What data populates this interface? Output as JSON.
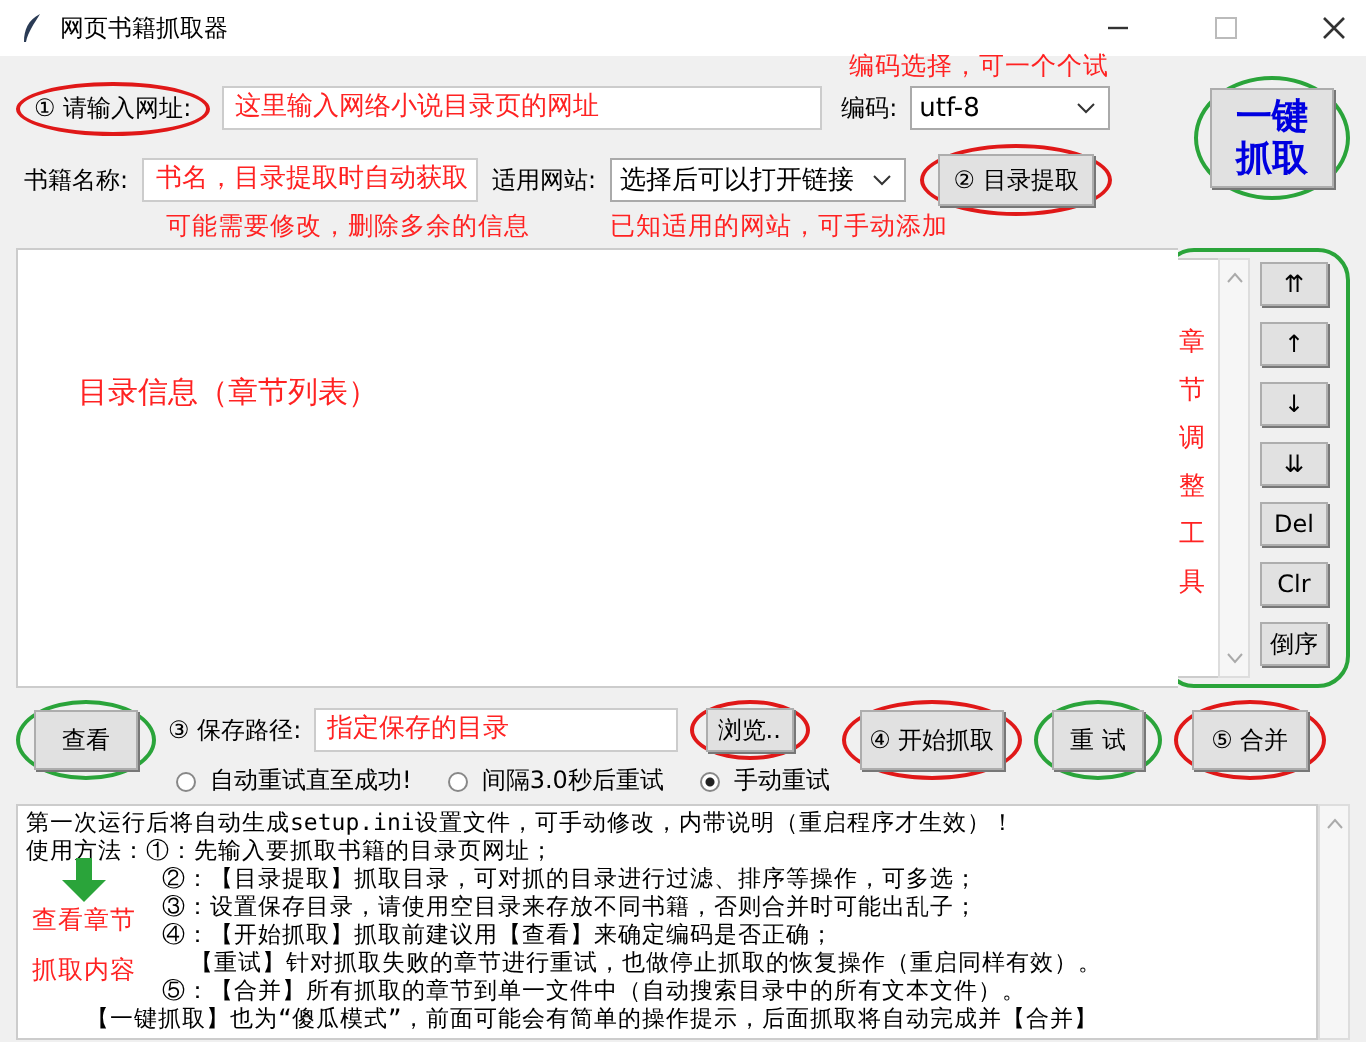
{
  "window": {
    "title": "网页书籍抓取器"
  },
  "url_row": {
    "label": "① 请输入网址:",
    "value": "这里输入网络小说目录页的网址",
    "encoding_label": "编码:",
    "encoding": "utf-8"
  },
  "one_click_button": "一键抓取",
  "book_row": {
    "label": "书籍名称:",
    "value": "书名，目录提取时自动获取",
    "site_label": "适用网站:",
    "site": "选择后可以打开链接",
    "extract_button": "② 目录提取"
  },
  "chapter_list": {
    "annotation": "目录信息（章节列表）"
  },
  "tool_buttons": [
    "⇈",
    "↑",
    "↓",
    "⇊",
    "Del",
    "Clr",
    "倒序"
  ],
  "save_row": {
    "view_button": "查看",
    "label": "③ 保存路径:",
    "value": "指定保存的目录",
    "browse_button": "浏览..",
    "start_button": "④ 开始抓取",
    "retry_button": "重 试",
    "merge_button": "⑤ 合并"
  },
  "retry_options": [
    {
      "label": "自动重试直至成功!",
      "selected": false
    },
    {
      "label": "间隔3.0秒后重试",
      "selected": false
    },
    {
      "label": "手动重试",
      "selected": true
    }
  ],
  "log_lines": [
    {
      "kind": "head",
      "text": "第一次运行后将自动生成setup.ini设置文件，可手动修改，内带说明（重启程序才生效）！"
    },
    {
      "kind": "head",
      "text": "使用方法：①：先输入要抓取书籍的目录页网址；"
    },
    {
      "kind": "step",
      "text": "②：【目录提取】抓取目录，可对抓的目录进行过滤、排序等操作，可多选；"
    },
    {
      "kind": "step",
      "text": "③：设置保存目录，请使用空目录来存放不同书籍，否则合并时可能出乱子；"
    },
    {
      "kind": "step",
      "text": "④：【开始抓取】抓取前建议用【查看】来确定编码是否正确；"
    },
    {
      "kind": "sub",
      "text": "【重试】针对抓取失败的章节进行重试，也做停止抓取的恢复操作（重启同样有效）。"
    },
    {
      "kind": "step",
      "text": "⑤：【合并】所有抓取的章节到单一文件中（自动搜索目录中的所有文本文件）。"
    },
    {
      "kind": "note",
      "text": "【一键抓取】也为“傻瓜模式”，前面可能会有简单的操作提示，后面抓取将自动完成并【合并】"
    }
  ],
  "annotations": {
    "encoding_hint": "编码选择，可一个个试",
    "name_hint": "可能需要修改，删除多余的信息",
    "site_hint": "已知适用的网站，可手动添加",
    "tools_hint": "章节调整工具",
    "view_hint": [
      "查看章节",
      "抓取内容"
    ]
  }
}
